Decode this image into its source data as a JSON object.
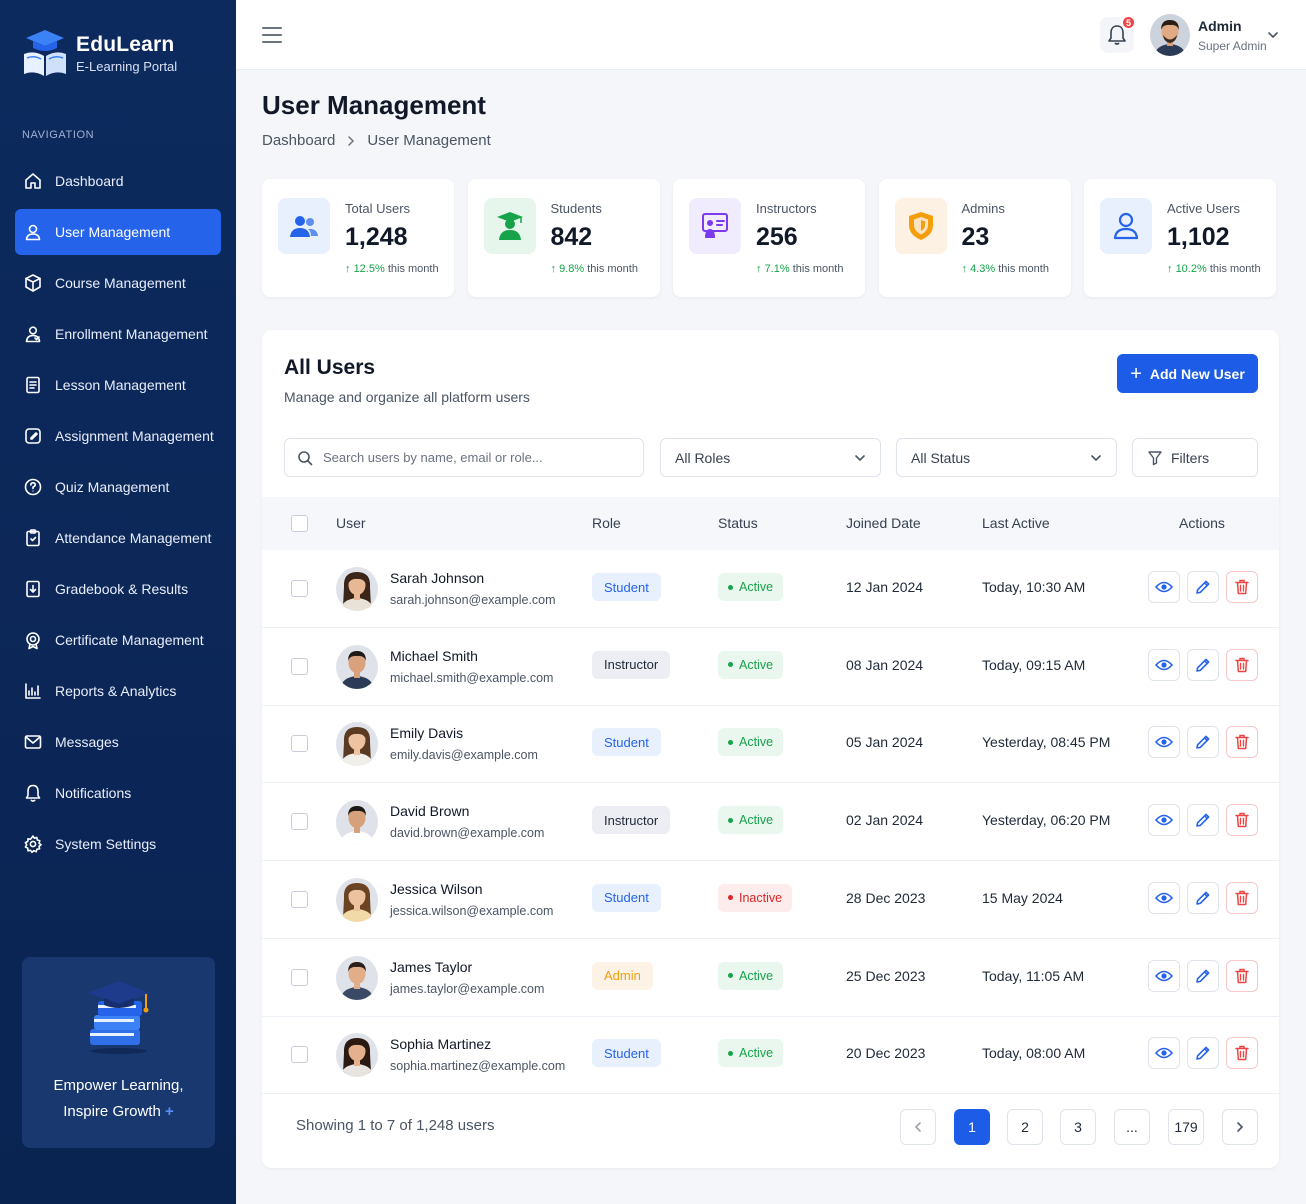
{
  "brand": {
    "name": "EduLearn",
    "subtitle": "E-Learning Portal"
  },
  "sidebar": {
    "heading": "NAVIGATION",
    "items": [
      {
        "label": "Dashboard",
        "icon": "home-icon"
      },
      {
        "label": "User Management",
        "icon": "user-icon",
        "active": true
      },
      {
        "label": "Course Management",
        "icon": "box-icon"
      },
      {
        "label": "Enrollment Management",
        "icon": "users-icon"
      },
      {
        "label": "Lesson Management",
        "icon": "document-icon"
      },
      {
        "label": "Assignment Management",
        "icon": "pencil-square-icon"
      },
      {
        "label": "Quiz Management",
        "icon": "question-icon"
      },
      {
        "label": "Attendance Management",
        "icon": "clipboard-icon"
      },
      {
        "label": "Gradebook & Results",
        "icon": "gradebook-icon"
      },
      {
        "label": "Certificate Management",
        "icon": "certificate-icon"
      },
      {
        "label": "Reports & Analytics",
        "icon": "chart-icon"
      },
      {
        "label": "Messages",
        "icon": "mail-icon"
      },
      {
        "label": "Notifications",
        "icon": "bell-icon"
      },
      {
        "label": "System Settings",
        "icon": "gear-icon"
      }
    ],
    "promo": {
      "line1": "Empower Learning,",
      "line2": "Inspire Growth",
      "plus": "+"
    }
  },
  "topbar": {
    "notification_count": "5",
    "user_name": "Admin",
    "user_role": "Super Admin"
  },
  "page": {
    "title": "User Management",
    "breadcrumb": [
      "Dashboard",
      "User Management"
    ]
  },
  "stats": [
    {
      "label": "Total Users",
      "value": "1,248",
      "trend": "12.5%",
      "trend_suffix": "this month",
      "icon": "users-icon",
      "color": "#2563eb",
      "bg": "#e8f0fd"
    },
    {
      "label": "Students",
      "value": "842",
      "trend": "9.8%",
      "trend_suffix": "this month",
      "icon": "graduate-icon",
      "color": "#16a34a",
      "bg": "#e7f6ec"
    },
    {
      "label": "Instructors",
      "value": "256",
      "trend": "7.1%",
      "trend_suffix": "this month",
      "icon": "presentation-icon",
      "color": "#7c3aed",
      "bg": "#f0ebfd"
    },
    {
      "label": "Admins",
      "value": "23",
      "trend": "4.3%",
      "trend_suffix": "this month",
      "icon": "shield-icon",
      "color": "#f59e0b",
      "bg": "#fdf1e4"
    },
    {
      "label": "Active Users",
      "value": "1,102",
      "trend": "10.2%",
      "trend_suffix": "this month",
      "icon": "user-icon",
      "color": "#2563eb",
      "bg": "#e8f0fd"
    }
  ],
  "users_panel": {
    "title": "All Users",
    "subtitle": "Manage and organize all platform users",
    "add_button": "Add New User",
    "search_placeholder": "Search users by name, email or role...",
    "role_filter": "All Roles",
    "status_filter": "All Status",
    "filters_button": "Filters",
    "columns": [
      "User",
      "Role",
      "Status",
      "Joined Date",
      "Last Active",
      "Actions"
    ],
    "rows": [
      {
        "name": "Sarah Johnson",
        "email": "sarah.johnson@example.com",
        "role": "Student",
        "status": "Active",
        "joined": "12 Jan 2024",
        "last_active": "Today, 10:30 AM",
        "hair": "#3b2418",
        "skin": "#e8b894",
        "shirt": "#e9e2d8"
      },
      {
        "name": "Michael Smith",
        "email": "michael.smith@example.com",
        "role": "Instructor",
        "status": "Active",
        "joined": "08 Jan 2024",
        "last_active": "Today, 09:15 AM",
        "hair": "#1f1a17",
        "skin": "#d9a27c",
        "shirt": "#2b3a55"
      },
      {
        "name": "Emily Davis",
        "email": "emily.davis@example.com",
        "role": "Student",
        "status": "Active",
        "joined": "05 Jan 2024",
        "last_active": "Yesterday, 08:45 PM",
        "hair": "#5a3b22",
        "skin": "#eec3a2",
        "shirt": "#f0efe9"
      },
      {
        "name": "David Brown",
        "email": "david.brown@example.com",
        "role": "Instructor",
        "status": "Active",
        "joined": "02 Jan 2024",
        "last_active": "Yesterday, 06:20 PM",
        "hair": "#1b1816",
        "skin": "#d6a07a",
        "shirt": "#ffffff"
      },
      {
        "name": "Jessica Wilson",
        "email": "jessica.wilson@example.com",
        "role": "Student",
        "status": "Inactive",
        "joined": "28 Dec 2023",
        "last_active": "15 May 2024",
        "hair": "#6b4423",
        "skin": "#edc29f",
        "shirt": "#f1d9a8"
      },
      {
        "name": "James Taylor",
        "email": "james.taylor@example.com",
        "role": "Admin",
        "status": "Active",
        "joined": "25 Dec 2023",
        "last_active": "Today, 11:05 AM",
        "hair": "#2b2019",
        "skin": "#e2ae89",
        "shirt": "#3a4a66"
      },
      {
        "name": "Sophia Martinez",
        "email": "sophia.martinez@example.com",
        "role": "Student",
        "status": "Active",
        "joined": "20 Dec 2023",
        "last_active": "Today, 08:00 AM",
        "hair": "#2a1a12",
        "skin": "#e4b08d",
        "shirt": "#e8e4df"
      }
    ],
    "pagination": {
      "info": "Showing 1 to 7 of 1,248 users",
      "pages": [
        "1",
        "2",
        "3",
        "...",
        "179"
      ],
      "current": "1"
    }
  },
  "colors": {
    "sidebar": "#0d2a5e",
    "accent": "#1d5ce6",
    "success": "#16a34a",
    "danger": "#dc2626",
    "warning": "#f59e0b"
  }
}
